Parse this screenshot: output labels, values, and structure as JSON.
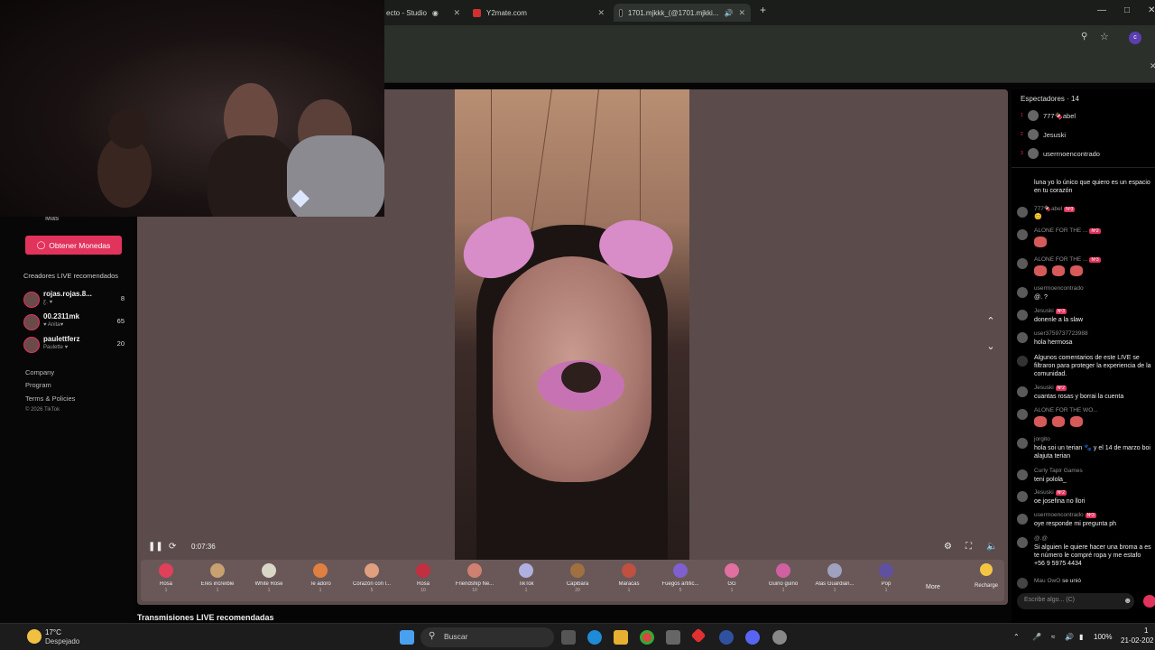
{
  "browser": {
    "tabs": [
      {
        "label": "ecto - Studio"
      },
      {
        "label": "Y2mate.com"
      },
      {
        "label": "1701.mjkkk_(@1701.mjkki..."
      }
    ],
    "new_tab": "+",
    "profile_initial": "c"
  },
  "sidebar": {
    "more_label": "Más",
    "coins_button": "Obtener Monedas",
    "recommended_title": "Creadores LIVE recomendados",
    "creators": [
      {
        "name": "rojas.rojas.8...",
        "sub": "ƹ. ♥",
        "count": "8"
      },
      {
        "name": "00.2311mk",
        "sub": "♥ Anita♥",
        "count": "65"
      },
      {
        "name": "paulettferz",
        "sub": "Paulette ♥",
        "count": "20"
      }
    ],
    "links": [
      "Company",
      "Program",
      "Terms & Policies"
    ],
    "copyright": "© 2026 TikTok"
  },
  "player": {
    "timecode": "0:07:36"
  },
  "gifts": [
    {
      "name": "Rosa",
      "price": "1",
      "color": "#e0405a"
    },
    {
      "name": "Eres increíble",
      "price": "1",
      "color": "#c9a070"
    },
    {
      "name": "White Rose",
      "price": "1",
      "color": "#d8d8c8"
    },
    {
      "name": "Te adoro",
      "price": "1",
      "color": "#e08040"
    },
    {
      "name": "Corazón con l...",
      "price": "5",
      "color": "#e0a080"
    },
    {
      "name": "Rosa",
      "price": "10",
      "color": "#c03040"
    },
    {
      "name": "Friendship Ne...",
      "price": "10",
      "color": "#d08070"
    },
    {
      "name": "TikTok",
      "price": "1",
      "color": "#b0b0e0"
    },
    {
      "name": "Capibara",
      "price": "20",
      "color": "#a07040"
    },
    {
      "name": "Maracas",
      "price": "1",
      "color": "#c05040"
    },
    {
      "name": "Fuegos artific...",
      "price": "5",
      "color": "#8060d0"
    },
    {
      "name": "GG",
      "price": "1",
      "color": "#e070a0"
    },
    {
      "name": "Guiño guiño",
      "price": "1",
      "color": "#d060a0"
    },
    {
      "name": "Alas Guardian...",
      "price": "1",
      "color": "#a0a0c0"
    },
    {
      "name": "Pop",
      "price": "1",
      "color": "#6050a0"
    }
  ],
  "gift_more": "More",
  "recharge": "Recharge",
  "recommended_live": "Transmisiones LIVE recomendadas",
  "chat": {
    "viewers_title": "Espectadores · 14",
    "viewers": [
      {
        "rank": "1",
        "name": "777🍫abel"
      },
      {
        "rank": "2",
        "name": "Jesuski"
      },
      {
        "rank": "3",
        "name": "userrnoencontrado"
      }
    ],
    "messages": [
      {
        "user": "",
        "badge": "",
        "text": "luna yo lo único que quiero es un espacio en tu corazón"
      },
      {
        "user": "777🍫abel",
        "badge": "Nº3",
        "text": "😊"
      },
      {
        "user": "ALONE FOR THE ...",
        "badge": "Nº2",
        "text": ""
      },
      {
        "user": "ALONE FOR THE ...",
        "badge": "Nº3",
        "text": ""
      },
      {
        "user": "userrnoencontrado",
        "badge": "",
        "text": "@. ?"
      },
      {
        "user": "Jesuski",
        "badge": "Nº3",
        "text": "donenle a la slaw"
      },
      {
        "user": "user3759737723988",
        "badge": "",
        "text": "hola hermosa"
      },
      {
        "user": "",
        "badge": "",
        "text": "Algunos comentarios de este LIVE se filtraron para proteger la experiencia de la comunidad."
      },
      {
        "user": "Jesuski",
        "badge": "Nº2",
        "text": "cuantas rosas y borrai la cuenta"
      },
      {
        "user": "ALONE FOR THE WO...",
        "badge": "",
        "text": ""
      },
      {
        "user": "jorgito",
        "badge": "",
        "text": "hola soi un terian 🐾 y el 14 de marzo boi alajuta terian"
      },
      {
        "user": "Curly Tapir Games",
        "badge": "",
        "text": "teni polola_"
      },
      {
        "user": "Jesuski",
        "badge": "Nº2",
        "text": "oe josefina no llori"
      },
      {
        "user": "userrnoencontrado",
        "badge": "Nº3",
        "text": "oye responde mi pregunta ph"
      },
      {
        "user": "@.@",
        "badge": "",
        "text": "Si alguien le quiere hacer una broma a es te número le compré ropa y me estafo +56 9 5975 4434"
      },
      {
        "user": "Mau OwO",
        "badge": "",
        "text": "se unió"
      }
    ],
    "input_placeholder": "Escribe algo... (C)"
  },
  "taskbar": {
    "temp": "17°C",
    "weather": "Despejado",
    "search": "Buscar",
    "battery": "100%",
    "time": "1",
    "date": "21-02-202"
  }
}
